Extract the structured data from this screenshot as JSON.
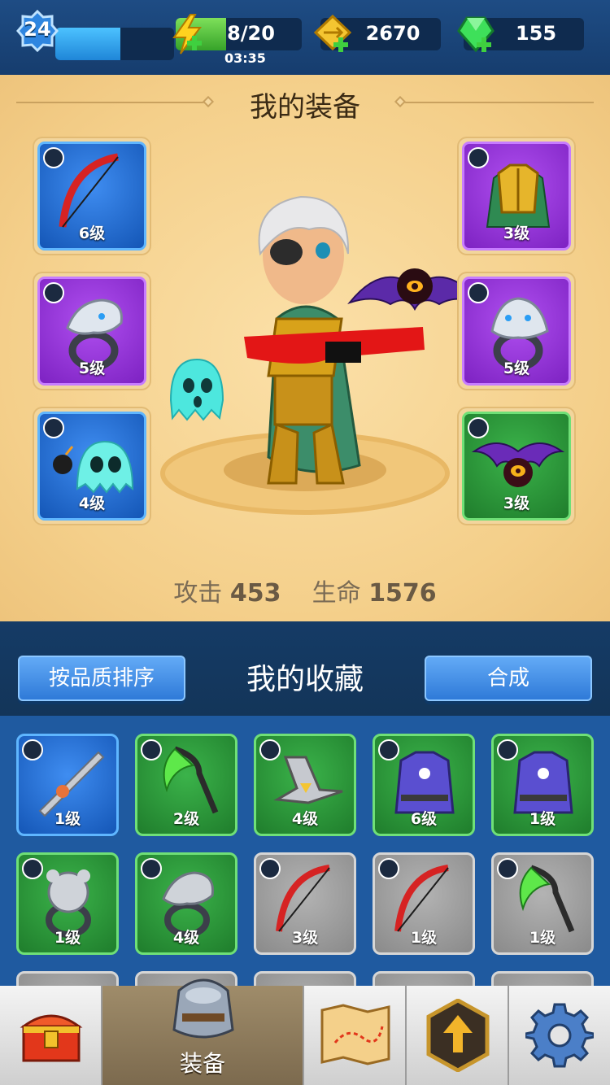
{
  "top_bar": {
    "level": "24",
    "level_progress": 0.55,
    "energy": "8/20",
    "energy_fraction": 0.4,
    "energy_timer": "03:35",
    "gold": "2670",
    "gems": "155"
  },
  "equipment": {
    "title": "我的装备",
    "left_slots": [
      {
        "item": "red-bow-icon",
        "level": "6级",
        "rarity": "blue"
      },
      {
        "item": "eagle-ring-icon",
        "level": "5级",
        "rarity": "purple"
      },
      {
        "item": "bomb-ghost-pet-icon",
        "level": "4级",
        "rarity": "blue"
      }
    ],
    "right_slots": [
      {
        "item": "golden-armor-icon",
        "level": "3级",
        "rarity": "purple"
      },
      {
        "item": "wolf-ring-icon",
        "level": "5级",
        "rarity": "purple"
      },
      {
        "item": "bat-pet-icon",
        "level": "3级",
        "rarity": "green"
      }
    ],
    "stats": {
      "attack_label": "攻击",
      "attack_value": "453",
      "hp_label": "生命",
      "hp_value": "1576"
    }
  },
  "collection": {
    "title": "我的收藏",
    "sort_button": "按品质排序",
    "merge_button": "合成",
    "items": [
      {
        "item": "spiked-sword-icon",
        "level": "1级",
        "rarity": "blue"
      },
      {
        "item": "green-scythe-icon",
        "level": "2级",
        "rarity": "green"
      },
      {
        "item": "shuriken-icon",
        "level": "4级",
        "rarity": "green"
      },
      {
        "item": "purple-robe-icon",
        "level": "6级",
        "rarity": "green"
      },
      {
        "item": "purple-robe-icon",
        "level": "1级",
        "rarity": "green"
      },
      {
        "item": "bear-ring-icon",
        "level": "1级",
        "rarity": "green"
      },
      {
        "item": "eagle-ring-icon",
        "level": "4级",
        "rarity": "green"
      },
      {
        "item": "red-bow-icon",
        "level": "3级",
        "rarity": "gray"
      },
      {
        "item": "red-bow-icon",
        "level": "1级",
        "rarity": "gray"
      },
      {
        "item": "green-scythe-icon",
        "level": "1级",
        "rarity": "gray"
      }
    ]
  },
  "nav": {
    "tabs": [
      {
        "icon": "treasure-chest-icon",
        "label": ""
      },
      {
        "icon": "armor-icon",
        "label": "装备"
      },
      {
        "icon": "map-icon",
        "label": ""
      },
      {
        "icon": "upgrade-arrow-icon",
        "label": ""
      },
      {
        "icon": "gear-icon",
        "label": ""
      }
    ]
  },
  "colors": {
    "rarity_blue": "#2a73d6",
    "rarity_purple": "#9b3de0",
    "rarity_green": "#2e9a3c",
    "rarity_gray": "#9a9a9a",
    "panel_bg": "#f4cf8a"
  }
}
